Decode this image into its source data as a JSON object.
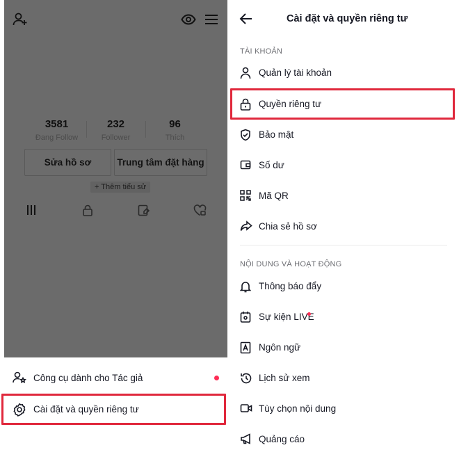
{
  "left": {
    "stats": [
      {
        "number": "3581",
        "label": "Đang Follow"
      },
      {
        "number": "232",
        "label": "Follower"
      },
      {
        "number": "96",
        "label": "Thích"
      }
    ],
    "buttons": {
      "edit_profile": "Sửa hồ sơ",
      "order_center": "Trung tâm đặt hàng"
    },
    "add_bio": "+ Thêm tiểu sử",
    "sheet": {
      "creator_tools": "Công cụ dành cho Tác giả",
      "settings": "Cài đặt và quyền riêng tư"
    }
  },
  "right": {
    "title": "Cài đặt và quyền riêng tư",
    "sections": [
      {
        "header": "TÀI KHOẢN",
        "items": [
          "Quản lý tài khoản",
          "Quyền riêng tư",
          "Bảo mật",
          "Số dư",
          "Mã QR",
          "Chia sẻ hồ sơ"
        ]
      },
      {
        "header": "NỘI DUNG VÀ HOẠT ĐỘNG",
        "items": [
          "Thông báo đẩy",
          "Sự kiện LIVE",
          "Ngôn ngữ",
          "Lịch sử xem",
          "Tùy chọn nội dung",
          "Quảng cáo"
        ]
      }
    ]
  },
  "colors": {
    "highlight": "#e0283c",
    "notification_dot": "#fe2c55",
    "overlay": "#6c6c6c"
  }
}
